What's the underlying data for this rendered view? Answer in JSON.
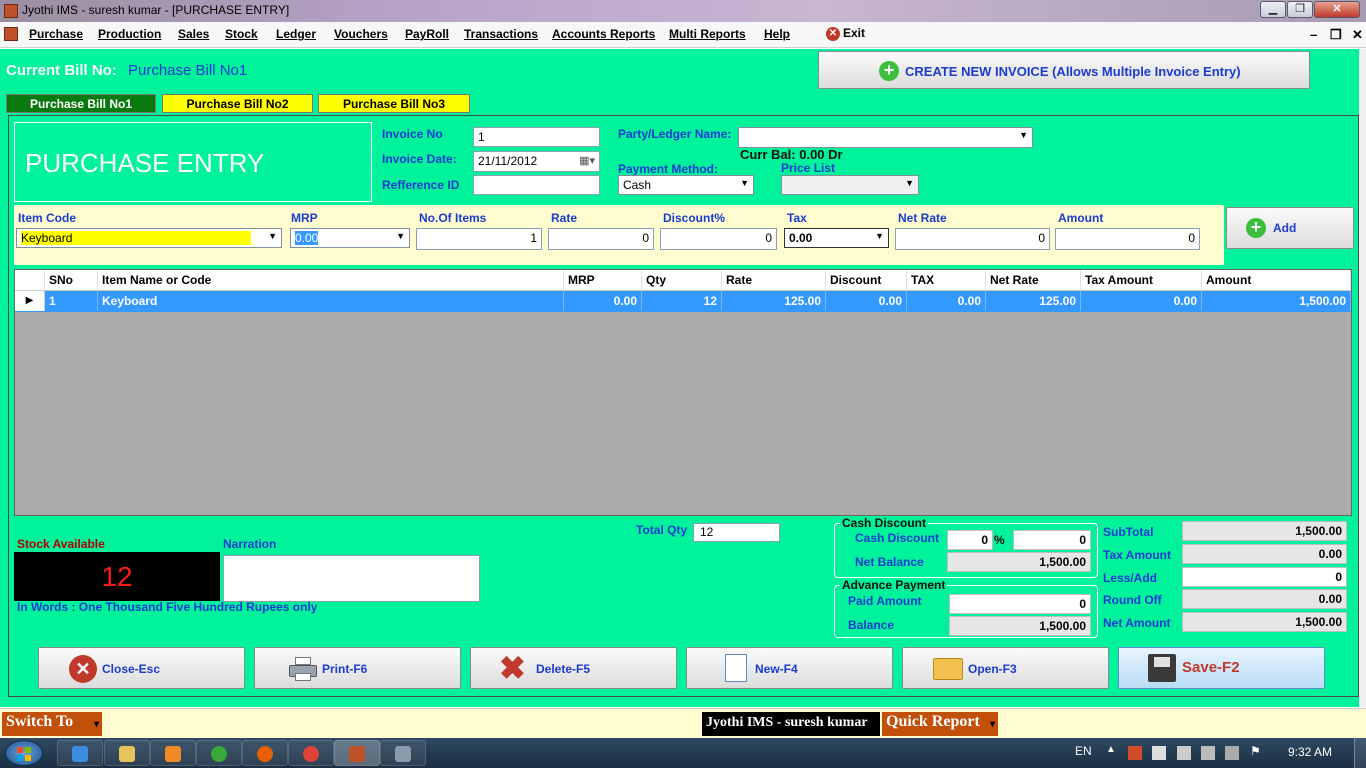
{
  "window": {
    "title": "Jyothi IMS - suresh kumar - [PURCHASE ENTRY]",
    "min_btn": "▁",
    "max_btn": "❐",
    "close_btn": "✕"
  },
  "menu": {
    "items": [
      "Purchase",
      "Production",
      "Sales",
      "Stock",
      "Ledger",
      "Vouchers",
      "PayRoll",
      "Transactions",
      "Accounts Reports",
      "Multi Reports",
      "Help"
    ],
    "exit": "Exit",
    "mdi_min": "–",
    "mdi_restore": "❐",
    "mdi_close": "✕"
  },
  "bill": {
    "current_label": "Current Bill No:",
    "current_value": "Purchase Bill No1",
    "create_button": "CREATE NEW INVOICE (Allows Multiple Invoice Entry)",
    "tabs": [
      "Purchase Bill No1",
      "Purchase Bill No2",
      "Purchase Bill No3"
    ]
  },
  "header": {
    "title": "PURCHASE ENTRY",
    "invoice_no_label": "Invoice No",
    "invoice_no": "1",
    "invoice_date_label": "Invoice Date:",
    "invoice_date": "21/11/2012",
    "reference_label": "Refference ID",
    "reference": "",
    "party_label": "Party/Ledger Name:",
    "party": "",
    "curr_bal": "Curr Bal: 0.00 Dr",
    "payment_label": "Payment Method:",
    "payment": "Cash",
    "price_list_label": "Price List",
    "price_list": ""
  },
  "entry": {
    "item_code_label": "Item Code",
    "item_code": "Keyboard",
    "mrp_label": "MRP",
    "mrp": "0.00",
    "items_label": "No.Of Items",
    "items": "1",
    "rate_label": "Rate",
    "rate": "0",
    "discount_label": "Discount%",
    "discount": "0",
    "tax_label": "Tax",
    "tax": "0.00",
    "net_rate_label": "Net Rate",
    "net_rate": "0",
    "amount_label": "Amount",
    "amount": "0",
    "add_button": "Add"
  },
  "grid": {
    "columns": [
      "SNo",
      "Item Name or Code",
      "MRP",
      "Qty",
      "Rate",
      "Discount",
      "TAX",
      "Net Rate",
      "Tax Amount",
      "Amount"
    ],
    "rows": [
      [
        "1",
        "Keyboard",
        "0.00",
        "12",
        "125.00",
        "0.00",
        "0.00",
        "125.00",
        "0.00",
        "1,500.00"
      ]
    ]
  },
  "footer": {
    "stock_label": "Stock Available",
    "stock_value": "12",
    "narration_label": "Narration",
    "narration": "",
    "in_words": "In Words : One Thousand Five Hundred  Rupees only",
    "total_qty_label": "Total Qty",
    "total_qty": "12",
    "cash_discount_group": "Cash Discount",
    "cash_discount_label": "Cash Discount",
    "cash_discount_pct": "0",
    "pct_sign": "%",
    "cash_discount_amt": "0",
    "net_balance_label": "Net Balance",
    "net_balance": "1,500.00",
    "advance_group": "Advance Payment",
    "paid_label": "Paid Amount",
    "paid": "0",
    "balance_label": "Balance",
    "balance": "1,500.00",
    "subtotal_label": "SubTotal",
    "subtotal": "1,500.00",
    "tax_amount_label": "Tax Amount",
    "tax_amount": "0.00",
    "less_add_label": "Less/Add",
    "less_add": "0",
    "round_off_label": "Round Off",
    "round_off": "0.00",
    "net_amount_label": "Net Amount",
    "net_amount": "1,500.00"
  },
  "actions": {
    "close": "Close-Esc",
    "print": "Print-F6",
    "delete": "Delete-F5",
    "new": "New-F4",
    "open": "Open-F3",
    "save": "Save-F2"
  },
  "status": {
    "switch_to": "Switch To",
    "app_user": "Jyothi IMS - suresh kumar",
    "quick_report": "Quick Report"
  },
  "taskbar": {
    "lang": "EN",
    "time": "9:32 AM"
  },
  "colors": {
    "form_bg": "#00f29a",
    "label_blue": "#1a3bd1",
    "active_tab": "#0a7a10",
    "inactive_tab": "#ffff00",
    "grid_selected": "#3399ff",
    "stock_text": "#ff0000"
  }
}
